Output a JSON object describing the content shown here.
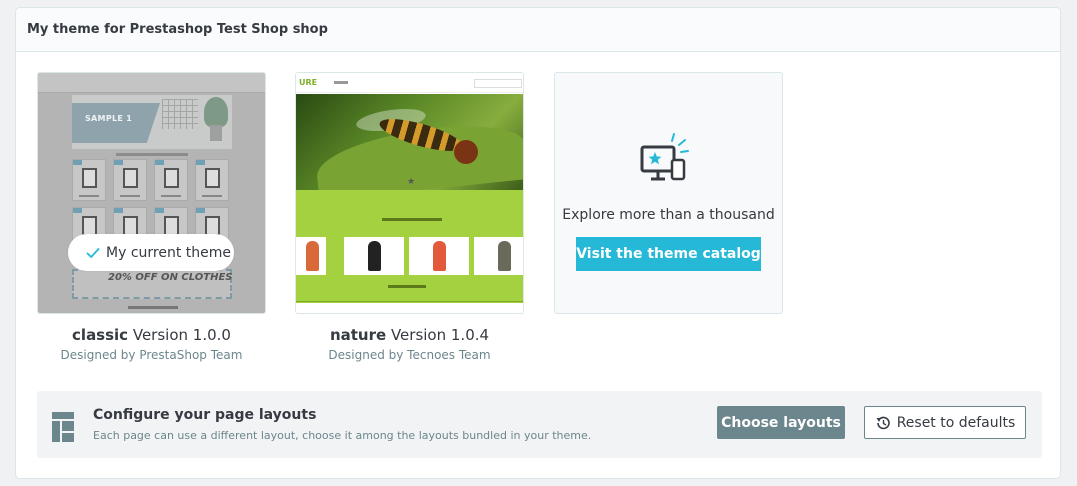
{
  "panel": {
    "title": "My theme for Prestashop Test Shop shop"
  },
  "themes": [
    {
      "name": "classic",
      "version": "Version 1.0.0",
      "author": "Designed by PrestaShop Team",
      "current_badge": "My current theme",
      "preview": {
        "hero_text": "SAMPLE 1",
        "sale_text": "20% OFF ON CLOTHES"
      }
    },
    {
      "name": "nature",
      "version": "Version 1.0.4",
      "author": "Designed by Tecnoes Team"
    }
  ],
  "catalog": {
    "text": "Explore more than a thousand themes",
    "button_label": "Visit the theme catalog",
    "icon": "monitor-phone-star-icon",
    "accent_color": "#25b9d7"
  },
  "layouts": {
    "title": "Configure your page layouts",
    "description": "Each page can use a different layout, choose it among the layouts bundled in your theme.",
    "choose_label": "Choose layouts",
    "reset_label": "Reset to defaults",
    "icon": "layout-grid-icon"
  },
  "colors": {
    "primary": "#25b9d7",
    "secondary": "#6c868e",
    "text": "#363a41"
  }
}
